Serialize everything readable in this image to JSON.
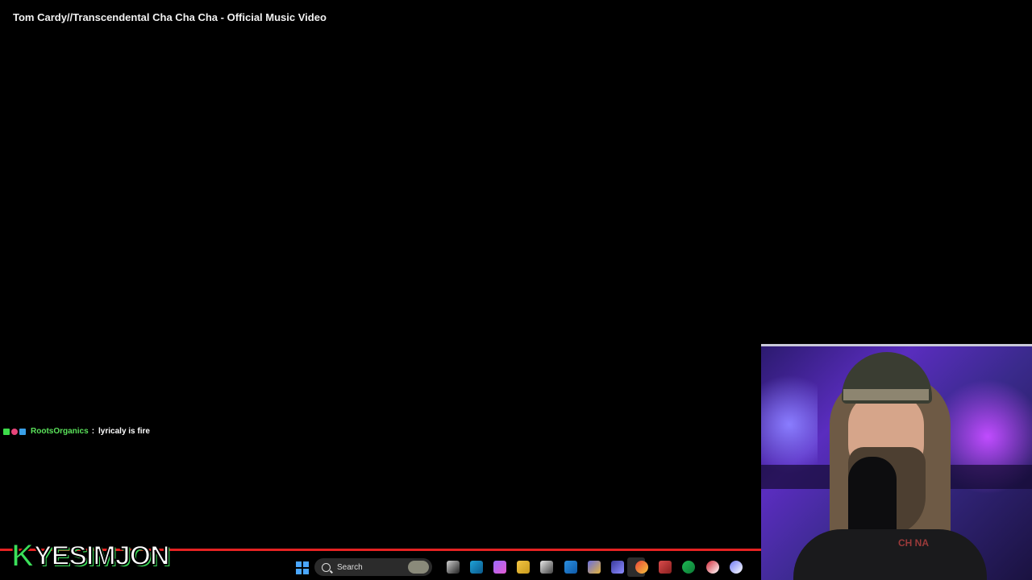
{
  "video": {
    "title": "Tom Cardy//Transcendental Cha Cha Cha - Official Music Video",
    "progress": 1.0
  },
  "chat": {
    "username": "RootsOrganics",
    "separator": ":",
    "message": "lyricaly is fire"
  },
  "overlay": {
    "logo_k": "K",
    "logo_text": "YESIMJON"
  },
  "webcam": {
    "shirt_text": "CH    NA"
  },
  "taskbar": {
    "search_label": "Search",
    "icons": [
      "windows-start-icon",
      "task-view-icon",
      "edge-icon",
      "copilot-icon",
      "file-explorer-icon",
      "store-icon",
      "mail-icon",
      "teams-icon",
      "app-icon",
      "chrome-icon",
      "maps-icon",
      "spotify-icon",
      "obs-icon",
      "discord-icon"
    ],
    "colors": {
      "accent": "#4aa7ff",
      "progress": "#e62222",
      "chat_user": "#5be35b"
    }
  }
}
